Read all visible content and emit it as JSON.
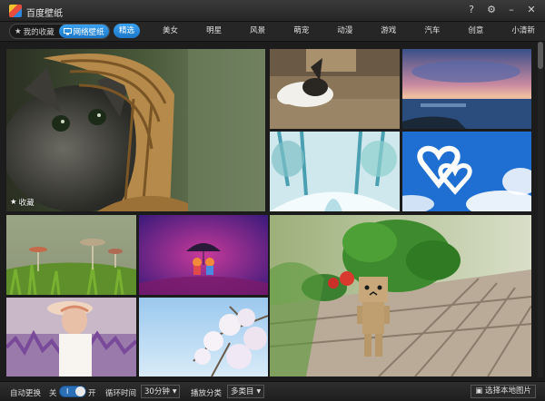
{
  "app": {
    "title": "百度壁纸"
  },
  "window": {
    "help": "?",
    "settings": "⚙",
    "minimize": "–",
    "close": "✕"
  },
  "nav": {
    "modes": [
      {
        "label": "我的收藏",
        "icon": "star-icon",
        "active": false
      },
      {
        "label": "网络壁纸",
        "icon": "monitor-icon",
        "active": true
      }
    ],
    "categories": [
      "精选",
      "美女",
      "明星",
      "风景",
      "萌宠",
      "动漫",
      "游戏",
      "汽车",
      "创意",
      "小清新"
    ],
    "active_category": "精选"
  },
  "gallery": {
    "favorite_label": "收藏",
    "thumbnails": [
      {
        "subject": "cat-in-basket"
      },
      {
        "subject": "sleeping-dog"
      },
      {
        "subject": "sunset-sea"
      },
      {
        "subject": "snowy-forest"
      },
      {
        "subject": "cloud-hearts"
      },
      {
        "subject": "mushrooms-grass"
      },
      {
        "subject": "couple-umbrella"
      },
      {
        "subject": "danbo-strawberry"
      },
      {
        "subject": "girl-flowers"
      },
      {
        "subject": "blossom-sky"
      }
    ]
  },
  "bottom": {
    "auto_change_label": "自动更换",
    "off_label": "关",
    "on_label": "开",
    "toggle_mark": "I",
    "interval_label": "循环时间",
    "interval_value": "30分钟",
    "category_label": "播放分类",
    "category_value": "多类目",
    "local_button": "选择本地图片"
  },
  "colors": {
    "accent": "#2a8de0",
    "background": "#1c1c1c",
    "bar": "#262626"
  }
}
